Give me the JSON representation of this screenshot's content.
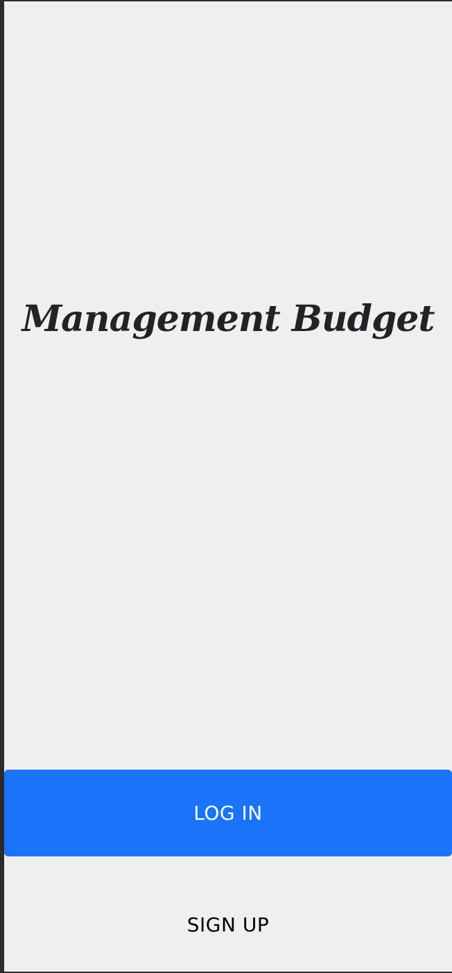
{
  "app": {
    "title": "Management Budget"
  },
  "actions": {
    "login_label": "LOG IN",
    "signup_label": "SIGN UP"
  },
  "colors": {
    "background": "#efeff0",
    "primary": "#1a73f8",
    "title_text": "#222326"
  }
}
